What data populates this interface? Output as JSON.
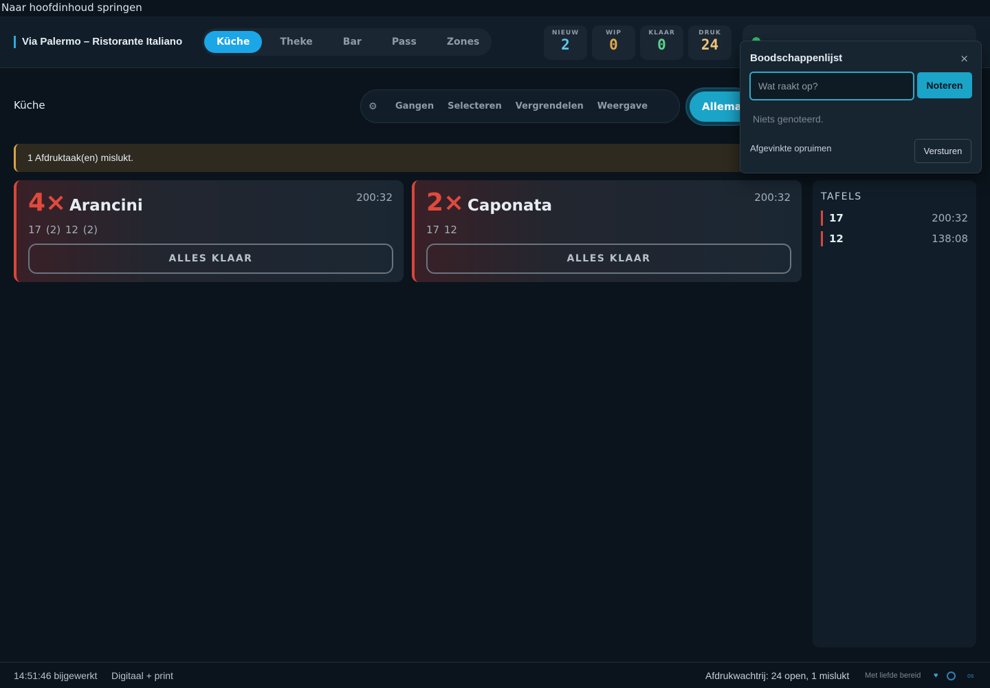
{
  "skip_link": "Naar hoofdinhoud springen",
  "header": {
    "venue": "Via Palermo – Ristorante Italiano",
    "stations": [
      {
        "label": "Küche",
        "active": true
      },
      {
        "label": "Theke",
        "active": false
      },
      {
        "label": "Bar",
        "active": false
      },
      {
        "label": "Pass",
        "active": false
      },
      {
        "label": "Zones",
        "active": false
      }
    ],
    "stats": [
      {
        "label": "NIEUW",
        "value": "2",
        "color": "#5fc8f0"
      },
      {
        "label": "WIP",
        "value": "0",
        "color": "#e0a84a"
      },
      {
        "label": "KLAAR",
        "value": "0",
        "color": "#5ad28a"
      },
      {
        "label": "DRUK",
        "value": "24",
        "color": "#f0c47a"
      }
    ]
  },
  "toolbar": {
    "section_title": "Küche",
    "gear_icon": "⚙",
    "buttons": [
      "Gangen",
      "Selecteren",
      "Vergrendelen",
      "Weergave"
    ],
    "filter_all": "Allemaal"
  },
  "alert": "1 Afdruktaak(en) mislukt.",
  "cards": [
    {
      "qty": "4×",
      "dish": "Arancini",
      "timer": "200:32",
      "tables": "17 (2)  12 (2)",
      "action": "ALLES KLAAR"
    },
    {
      "qty": "2×",
      "dish": "Caponata",
      "timer": "200:32",
      "tables": "17  12",
      "action": "ALLES KLAAR"
    }
  ],
  "tables_panel": {
    "title": "TAFELS",
    "rows": [
      {
        "table": "17",
        "time": "200:32"
      },
      {
        "table": "12",
        "time": "138:08"
      }
    ]
  },
  "popup": {
    "title": "Boodschappenlijst",
    "close": "×",
    "input_placeholder": "Wat raakt op?",
    "add_label": "Noteren",
    "empty": "Niets genoteerd.",
    "clear_label": "Afgevinkte opruimen",
    "send_label": "Versturen"
  },
  "footer": {
    "updated": "14:51:46 bijgewerkt",
    "mode": "Digitaal + print",
    "queue": "Afdrukwachtrij: 24 open, 1 mislukt",
    "love": "Met liefde bereid",
    "heart": "♥",
    "os_label": "os"
  }
}
